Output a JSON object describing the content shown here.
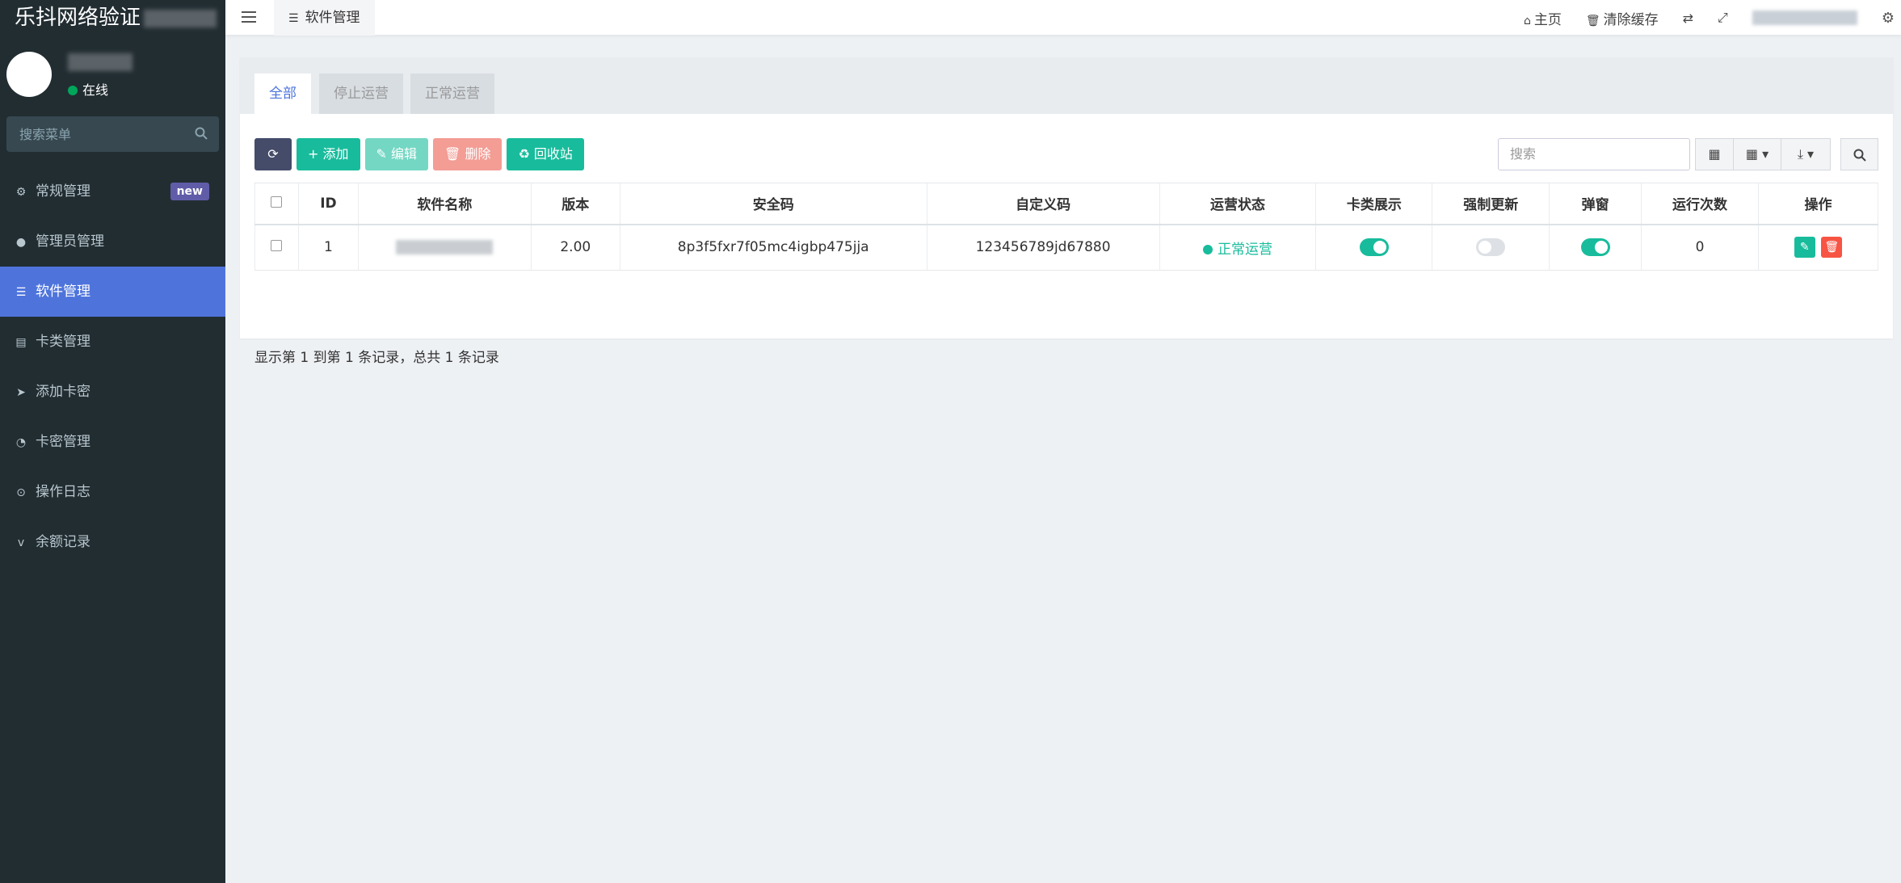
{
  "sidebar": {
    "app_title": "乐抖网络验证",
    "status": "在线",
    "search_placeholder": "搜索菜单",
    "items": [
      {
        "label": "常规管理",
        "icon": "cogs-icon",
        "badge": "new"
      },
      {
        "label": "管理员管理",
        "icon": "user-icon"
      },
      {
        "label": "软件管理",
        "icon": "list-icon"
      },
      {
        "label": "卡类管理",
        "icon": "card-list-icon"
      },
      {
        "label": "添加卡密",
        "icon": "paper-plane-icon"
      },
      {
        "label": "卡密管理",
        "icon": "rss-icon"
      },
      {
        "label": "操作日志",
        "icon": "clock-icon"
      },
      {
        "label": "余额记录",
        "icon": "vimeo-icon"
      }
    ]
  },
  "header": {
    "tab_label": "软件管理",
    "home": "主页",
    "clear_cache": "清除缓存"
  },
  "tabs": [
    "全部",
    "停止运营",
    "正常运营"
  ],
  "toolbar": {
    "add": "添加",
    "edit": "编辑",
    "delete": "删除",
    "recycle": "回收站",
    "search_placeholder": "搜索"
  },
  "table": {
    "columns": [
      "ID",
      "软件名称",
      "版本",
      "安全码",
      "自定义码",
      "运营状态",
      "卡类展示",
      "强制更新",
      "弹窗",
      "运行次数",
      "操作"
    ],
    "rows": [
      {
        "id": "1",
        "version": "2.00",
        "security_code": "8p3f5fxr7f05mc4igbp475jja",
        "custom_code": "123456789jd67880",
        "status": "正常运营",
        "card_display": true,
        "force_update": false,
        "popup": true,
        "run_count": "0"
      }
    ]
  },
  "pager": "显示第 1 到第 1 条记录，总共 1 条记录",
  "colors": {
    "sidebar_bg": "#222d32",
    "active": "#4e74dc",
    "green": "#18bc9c",
    "red": "#f75444"
  }
}
